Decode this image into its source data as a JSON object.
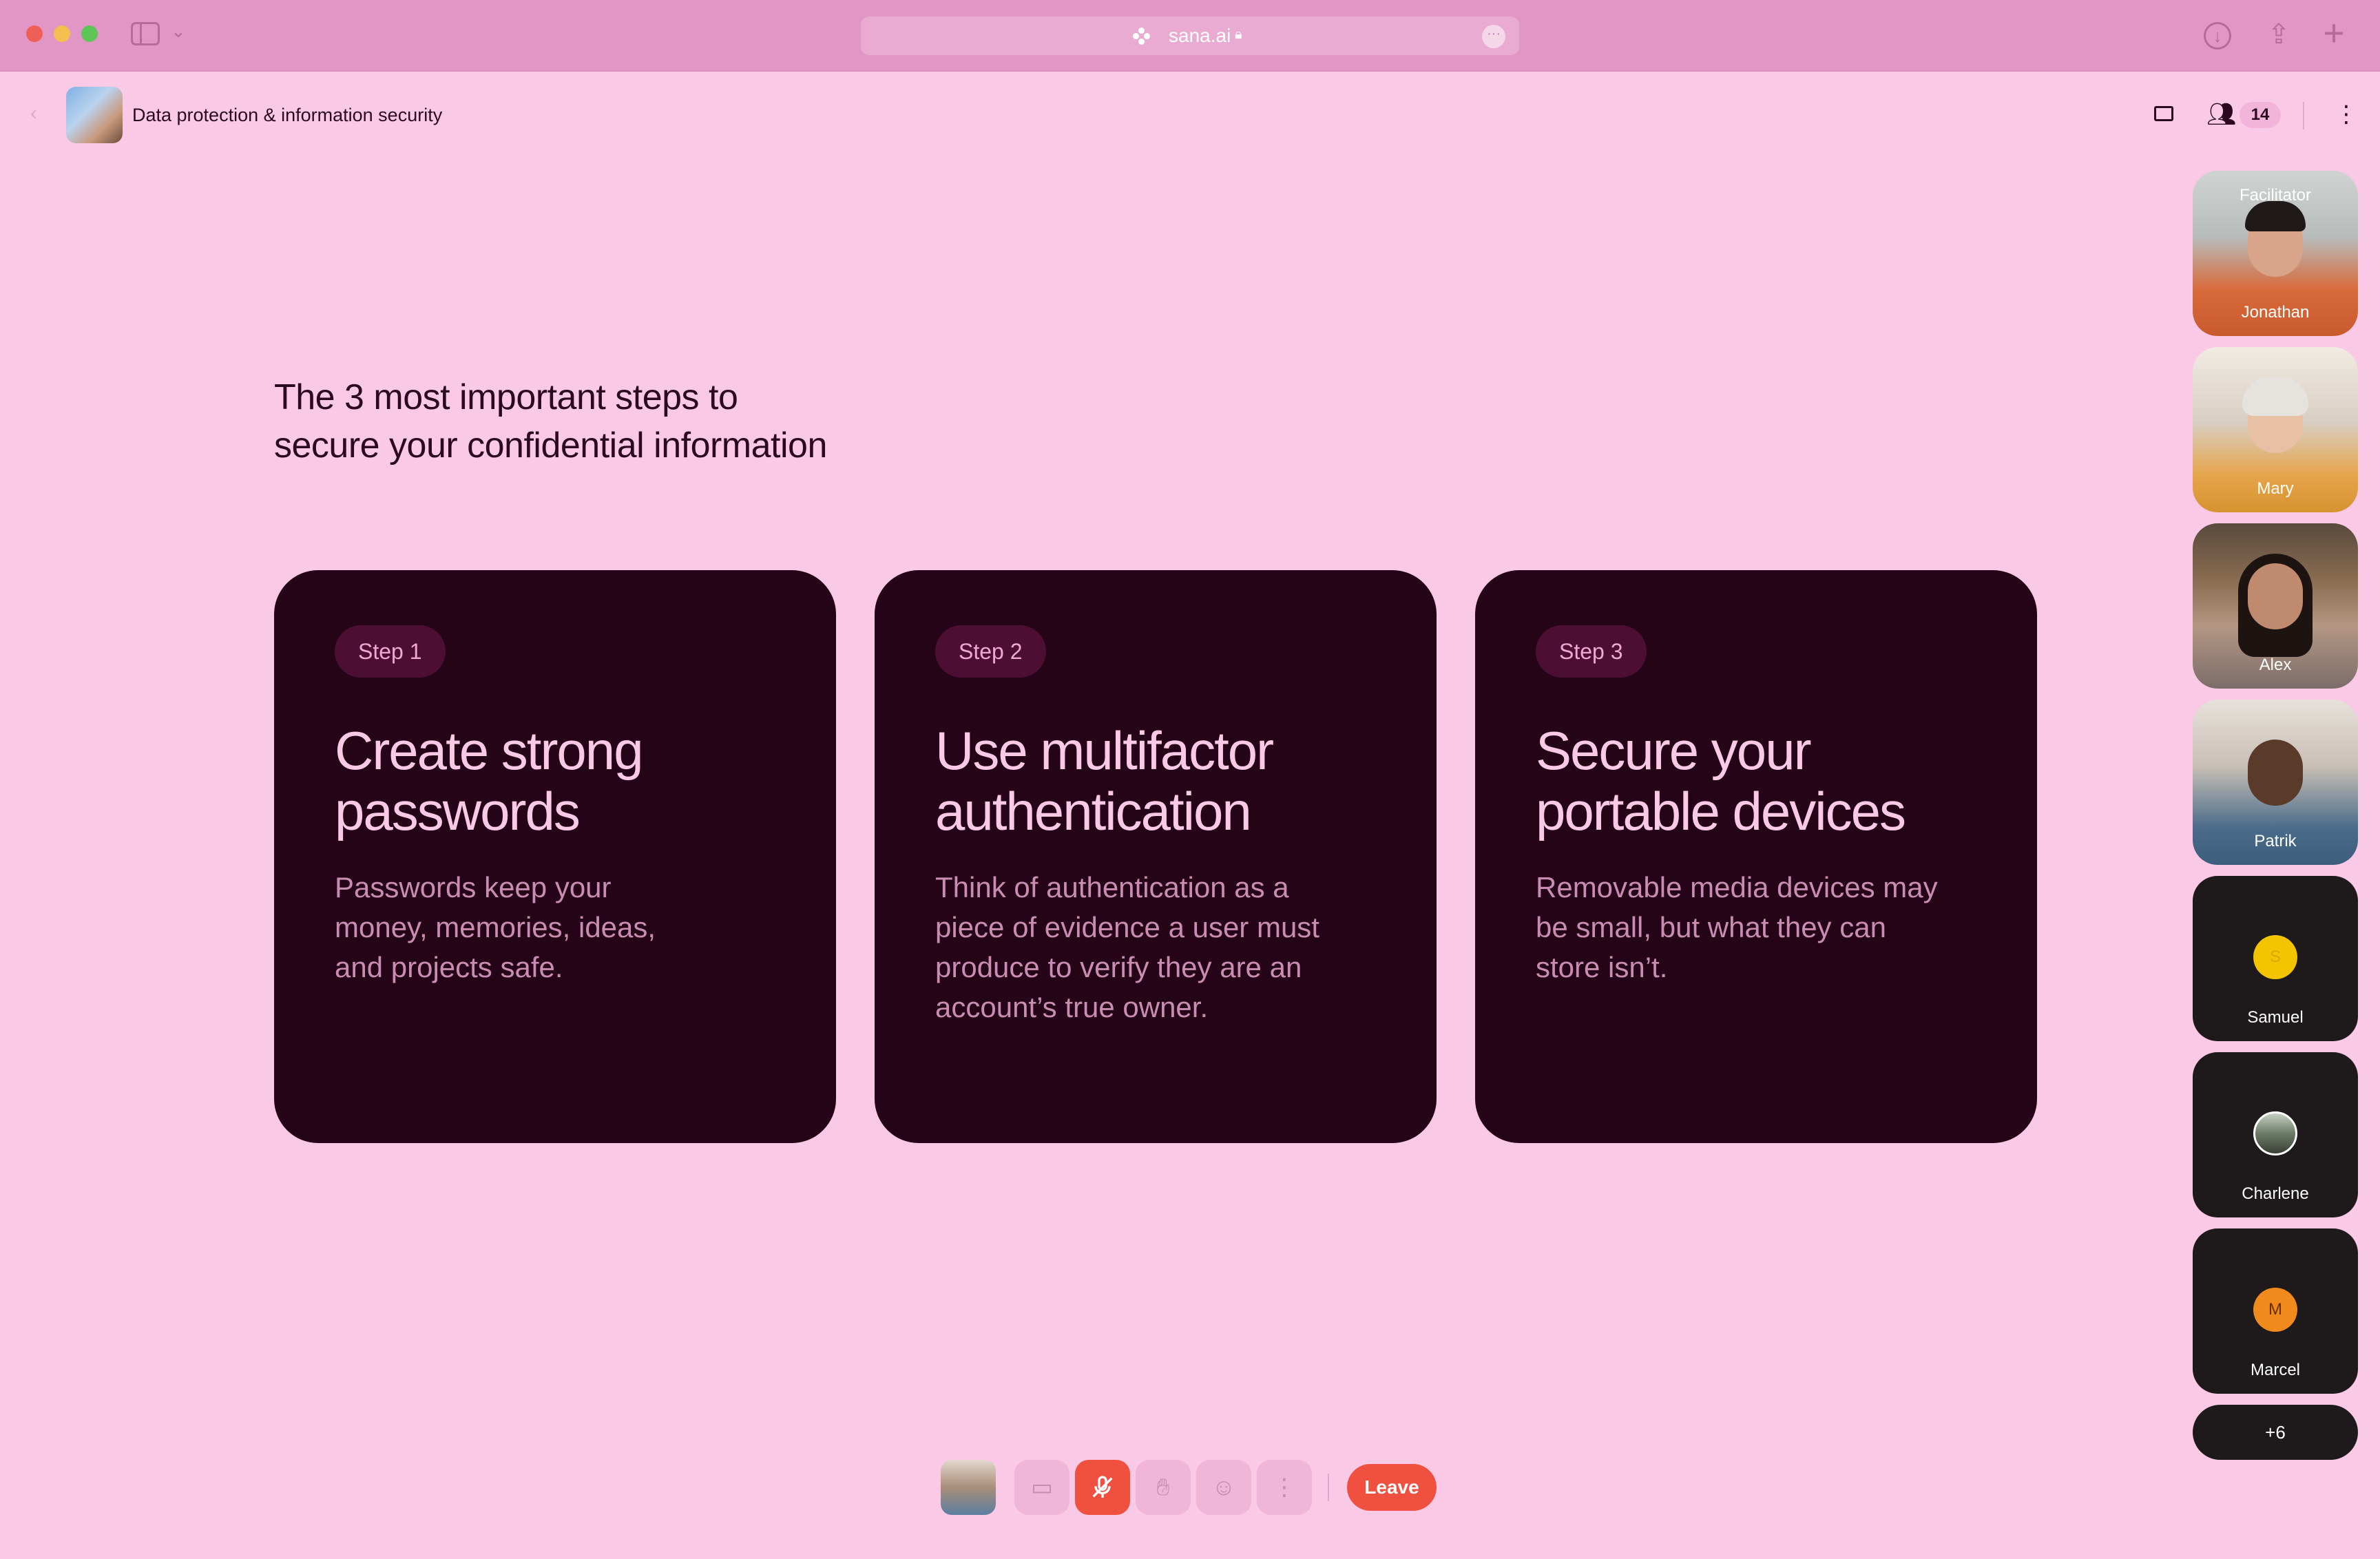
{
  "browser": {
    "url": "sana.ai",
    "icons": {
      "sidebar": "sidebar-icon",
      "chevron": "chevron-down-icon",
      "lock": "lock-icon",
      "more": "more-horizontal-icon",
      "download": "download-icon",
      "share": "share-icon",
      "new_tab": "plus-icon"
    }
  },
  "header": {
    "title": "Data protection & information security",
    "participant_count": "14",
    "icons": {
      "back": "chevron-left-icon",
      "chat": "chat-icon",
      "participants": "people-icon",
      "more": "more-vertical-icon"
    }
  },
  "slide": {
    "headline_line1": "The 3 most important steps to",
    "headline_line2": "secure your confidential information",
    "steps": [
      {
        "label": "Step 1",
        "title_line1": "Create strong",
        "title_line2": "passwords",
        "body": "Passwords keep your money, memories, ideas, and projects safe."
      },
      {
        "label": "Step 2",
        "title_line1": "Use multifactor",
        "title_line2": "authentication",
        "body": "Think of authentication as a piece of evidence a user must produce to verify they are an account’s true owner."
      },
      {
        "label": "Step 3",
        "title_line1": "Secure your",
        "title_line2": "portable devices",
        "body": "Removable media devices may be small, but what they can store isn’t."
      }
    ]
  },
  "participants": {
    "tiles": [
      {
        "name": "Jonathan",
        "role": "Facilitator",
        "type": "video"
      },
      {
        "name": "Mary",
        "type": "video"
      },
      {
        "name": "Alex",
        "type": "video"
      },
      {
        "name": "Patrik",
        "type": "video"
      },
      {
        "name": "Samuel",
        "type": "avatar",
        "initial": "S",
        "color": "#f5c400"
      },
      {
        "name": "Charlene",
        "type": "avatar-photo"
      },
      {
        "name": "Marcel",
        "type": "avatar",
        "initial": "M",
        "color": "#f08a1c"
      }
    ],
    "more_label": "+6"
  },
  "controls": {
    "leave_label": "Leave",
    "icons": {
      "camera": "camera-off-icon",
      "mic": "mic-off-icon",
      "hand": "raise-hand-icon",
      "emoji": "emoji-icon",
      "more": "more-vertical-icon"
    },
    "colors": {
      "danger": "#f0503f",
      "card_bg": "#250417",
      "page_bg": "#f9c9e6"
    }
  }
}
